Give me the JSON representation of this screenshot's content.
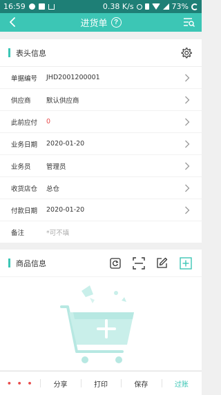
{
  "status_bar": {
    "time": "16:59",
    "network_speed": "0.38 K/s",
    "battery": "73%"
  },
  "navbar": {
    "back_icon": "chevron-left-icon",
    "title": "进货单",
    "help_glyph": "?",
    "menu_icon": "list-search-icon"
  },
  "header_section": {
    "title": "表头信息",
    "settings_icon": "gear-icon",
    "fields": [
      {
        "label": "单据编号",
        "value": "JHD2001200001",
        "has_arrow": true
      },
      {
        "label": "供应商",
        "value": "默认供应商",
        "has_arrow": true
      },
      {
        "label": "此前应付",
        "value": "0",
        "has_arrow": true,
        "value_color": "#e84a4a"
      },
      {
        "label": "业务日期",
        "value": "2020-01-20",
        "has_arrow": true
      },
      {
        "label": "业务员",
        "value": "管理员",
        "has_arrow": true
      },
      {
        "label": "收货店仓",
        "value": "总仓",
        "has_arrow": true
      },
      {
        "label": "付款日期",
        "value": "2020-01-20",
        "has_arrow": true
      },
      {
        "label": "备注",
        "placeholder": "*可不填",
        "has_arrow": false
      }
    ]
  },
  "goods_section": {
    "title": "商品信息",
    "tools": [
      "refresh-icon",
      "scan-icon",
      "edit-icon",
      "add-icon"
    ],
    "empty_illustration": "empty-cart-icon"
  },
  "bottom_bar": {
    "more": "• • •",
    "share": "分享",
    "print": "打印",
    "save": "保存",
    "post": "过账"
  },
  "colors": {
    "accent": "#3cc6b5",
    "status_bar": "#1e7f76",
    "warning_red": "#e84a4a"
  }
}
